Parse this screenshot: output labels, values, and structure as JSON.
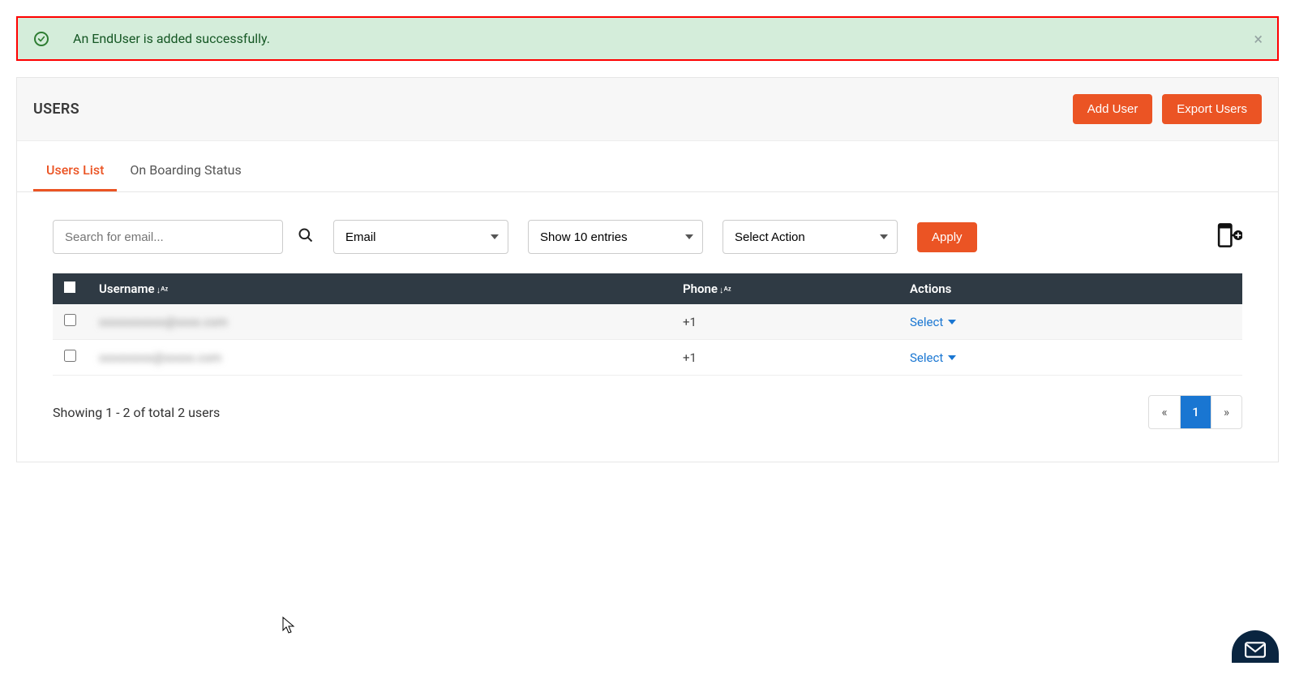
{
  "alert": {
    "message": "An EndUser is added successfully."
  },
  "page_title": "USERS",
  "header_buttons": {
    "add_user": "Add User",
    "export_users": "Export Users"
  },
  "tabs": [
    {
      "label": "Users List",
      "active": true
    },
    {
      "label": "On Boarding Status",
      "active": false
    }
  ],
  "filters": {
    "search_placeholder": "Search for email...",
    "search_value": "",
    "filter_by": "Email",
    "show_entries": "Show 10 entries",
    "action": "Select Action",
    "apply_label": "Apply"
  },
  "table": {
    "columns": {
      "username": "Username",
      "phone": "Phone",
      "actions": "Actions"
    },
    "rows": [
      {
        "username": "xxxxxxxxxxx@xxxx.com",
        "phone": "+1",
        "action_label": "Select"
      },
      {
        "username": "xxxxxxxxx@xxxxx.com",
        "phone": "+1",
        "action_label": "Select"
      }
    ]
  },
  "footer": {
    "summary": "Showing 1 - 2 of total 2 users",
    "prev": "«",
    "next": "»",
    "current_page": "1"
  },
  "colors": {
    "accent": "#eb5424",
    "primary_blue": "#1976d2",
    "alert_border": "#ff0000",
    "alert_bg": "#d4edda",
    "table_header_bg": "#2f3a44"
  }
}
